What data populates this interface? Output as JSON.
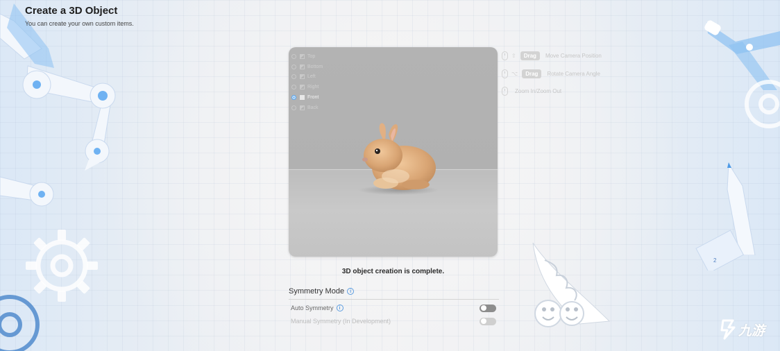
{
  "header": {
    "title": "Create a 3D Object",
    "subtitle": "You can create your own custom items."
  },
  "viewport": {
    "views": [
      {
        "label": "Top",
        "active": false
      },
      {
        "label": "Bottom",
        "active": false
      },
      {
        "label": "Left",
        "active": false
      },
      {
        "label": "Right",
        "active": false
      },
      {
        "label": "Front",
        "active": true
      },
      {
        "label": "Back",
        "active": false
      }
    ]
  },
  "controls": [
    {
      "modifier": "⇧",
      "badge": "Drag",
      "action": "Move Camera Position"
    },
    {
      "modifier": "⌥",
      "badge": "Drag",
      "action": "Rotate Camera Angle"
    },
    {
      "modifier": "",
      "badge": "",
      "action": "Zoom In/Zoom Out"
    }
  ],
  "status": {
    "message": "3D object creation is complete."
  },
  "symmetry": {
    "title": "Symmetry Mode",
    "options": [
      {
        "label": "Auto Symmetry",
        "enabled": false,
        "disabled": false
      },
      {
        "label": "Manual Symmetry (In Development)",
        "enabled": false,
        "disabled": true
      }
    ]
  },
  "watermark": {
    "text": "九游"
  },
  "colors": {
    "accent": "#5aa6ee",
    "background": "#eef0f3",
    "viewport": "#b3b3b3"
  }
}
